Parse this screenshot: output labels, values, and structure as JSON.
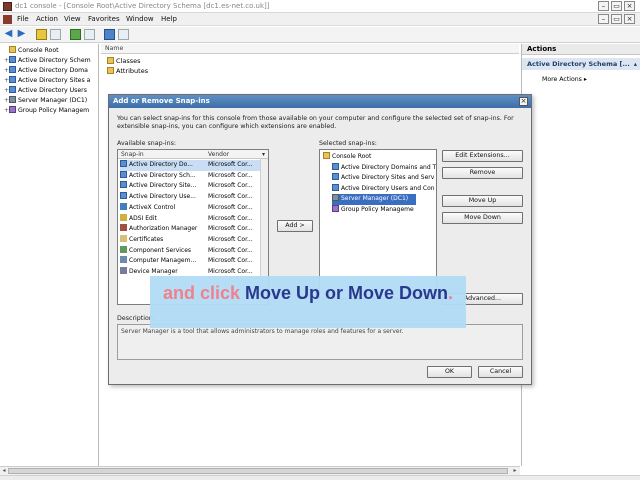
{
  "window": {
    "title": "dc1 console - [Console Root\\Active Directory Schema [dc1.es-net.co.uk]]",
    "controls": [
      "–",
      "▭",
      "×"
    ]
  },
  "menubar": {
    "items": [
      "File",
      "Action",
      "View",
      "Favorites",
      "Window",
      "Help"
    ],
    "mdi_controls": [
      "–",
      "▭",
      "×"
    ]
  },
  "tree": {
    "nodes": [
      {
        "label": "Console Root",
        "icon": "folder-icon",
        "expander": ""
      },
      {
        "label": "Active Directory Schem",
        "icon": "ad-icon",
        "expander": "+"
      },
      {
        "label": "Active Directory Doma",
        "icon": "ad-icon",
        "expander": "+"
      },
      {
        "label": "Active Directory Sites a",
        "icon": "ad-icon",
        "expander": "+"
      },
      {
        "label": "Active Directory Users",
        "icon": "ad-icon",
        "expander": "+"
      },
      {
        "label": "Server Manager (DC1)",
        "icon": "server-icon",
        "expander": "+"
      },
      {
        "label": "Group Policy Managem",
        "icon": "group-policy-icon",
        "expander": "+"
      }
    ]
  },
  "center": {
    "column_header": "Name",
    "rows": [
      "Classes",
      "Attributes"
    ]
  },
  "actions": {
    "header": "Actions",
    "section": "Active Directory Schema [...",
    "section_arrow": "▴",
    "more": "More Actions",
    "more_arrow": "▸"
  },
  "dialog": {
    "title": "Add or Remove Snap-ins",
    "close": "×",
    "description": "You can select snap-ins for this console from those available on your computer and configure the selected set of snap-ins. For extensible snap-ins, you can configure which extensions are enabled.",
    "available_label": "Available snap-ins:",
    "selected_label": "Selected snap-ins:",
    "columns": {
      "snapin": "Snap-in",
      "vendor": "Vendor"
    },
    "available": [
      {
        "name": "Active Directory Do...",
        "vendor": "Microsoft Cor...",
        "icon": "ad-icon"
      },
      {
        "name": "Active Directory Sch...",
        "vendor": "Microsoft Cor...",
        "icon": "ad-icon"
      },
      {
        "name": "Active Directory Site...",
        "vendor": "Microsoft Cor...",
        "icon": "ad-icon"
      },
      {
        "name": "Active Directory Use...",
        "vendor": "Microsoft Cor...",
        "icon": "ad-icon"
      },
      {
        "name": "ActiveX Control",
        "vendor": "Microsoft Cor...",
        "icon": "activex-icon"
      },
      {
        "name": "ADSI Edit",
        "vendor": "Microsoft Cor...",
        "icon": "adsi-icon"
      },
      {
        "name": "Authorization Manager",
        "vendor": "Microsoft Cor...",
        "icon": "auth-icon"
      },
      {
        "name": "Certificates",
        "vendor": "Microsoft Cor...",
        "icon": "certificate-icon"
      },
      {
        "name": "Component Services",
        "vendor": "Microsoft Cor...",
        "icon": "component-icon"
      },
      {
        "name": "Computer Managem...",
        "vendor": "Microsoft Cor...",
        "icon": "computer-icon"
      },
      {
        "name": "Device Manager",
        "vendor": "Microsoft Cor...",
        "icon": "device-icon"
      }
    ],
    "add_button": "Add >",
    "selected": [
      {
        "name": "Console Root",
        "icon": "folder-icon",
        "indent": 0,
        "selected": false
      },
      {
        "name": "Active Directory Domains and T",
        "icon": "ad-icon",
        "indent": 1,
        "selected": false
      },
      {
        "name": "Active Directory Sites and Serv",
        "icon": "ad-icon",
        "indent": 1,
        "selected": false
      },
      {
        "name": "Active Directory Users and Con",
        "icon": "ad-icon",
        "indent": 1,
        "selected": false
      },
      {
        "name": "Server Manager (DC1)",
        "icon": "server-icon",
        "indent": 1,
        "selected": true
      },
      {
        "name": "Group Policy Manageme",
        "icon": "group-policy-icon",
        "indent": 1,
        "selected": false
      }
    ],
    "buttons": {
      "edit_extensions": "Edit Extensions...",
      "remove": "Remove",
      "move_up": "Move Up",
      "move_down": "Move Down",
      "advanced": "Advanced...",
      "ok": "OK",
      "cancel": "Cancel"
    },
    "description_label": "Description:",
    "description_text": "Server Manager is a tool that allows administrators to manage roles and features for a server."
  },
  "callout": {
    "part1": "and click ",
    "part2": "Move Up or Move Down",
    "part3": "."
  },
  "colors": {
    "dialog_title": "#3d6ea8",
    "selection": "#3a6ec0",
    "callout_bg": "#b2dcf6",
    "callout_pink": "#f07a86",
    "callout_navy": "#1f2e8a"
  }
}
